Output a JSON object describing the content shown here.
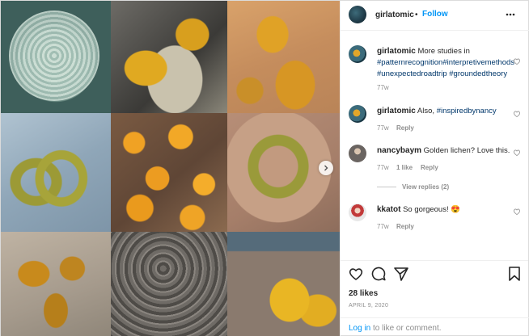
{
  "post": {
    "author": "girlatomic",
    "follow_label": "Follow",
    "caption": {
      "prefix": "More studies in",
      "tags": [
        "#patternrecognition",
        "#interpretivemethods",
        "#unexpectedroadtrip",
        "#groundedtheory"
      ],
      "age": "77w"
    }
  },
  "comments": [
    {
      "user": "girlatomic",
      "text": "Also,",
      "tag": "#inspiredbynancy",
      "age": "77w",
      "reply": "Reply"
    },
    {
      "user": "nancybaym",
      "text": "Golden lichen? Love this.",
      "age": "77w",
      "likes": "1 like",
      "reply": "Reply",
      "view_replies": "View replies (2)"
    },
    {
      "user": "kkatot",
      "text": "So gorgeous!",
      "emoji": "😍",
      "age": "77w",
      "reply": "Reply"
    }
  ],
  "footer": {
    "likes": "28 likes",
    "date": "APRIL 9, 2020",
    "login_link": "Log in",
    "login_rest": "to like or comment."
  },
  "icons": [
    "heart-icon",
    "comment-icon",
    "share-icon",
    "bookmark-icon",
    "more-icon",
    "chevron-right-icon"
  ],
  "colors": {
    "link_blue": "#0095f6",
    "hashtag": "#00376b",
    "muted": "#8e8e8e"
  }
}
